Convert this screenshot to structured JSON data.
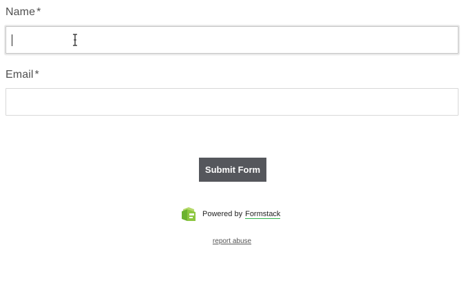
{
  "form": {
    "name_field": {
      "label": "Name",
      "required_mark": "*",
      "value": ""
    },
    "email_field": {
      "label": "Email",
      "required_mark": "*",
      "value": ""
    },
    "submit_label": "Submit Form"
  },
  "footer": {
    "powered_by": "Powered by",
    "brand": "Formstack",
    "brand_icon": "formstack-logo-icon",
    "report_abuse": "report abuse"
  },
  "colors": {
    "button_bg": "#55575c",
    "brand_green": "#8cc63f",
    "link_underline": "#2db34a"
  }
}
